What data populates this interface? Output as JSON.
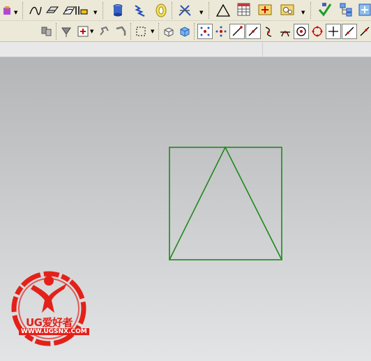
{
  "toolbar_top": {
    "icons": [
      "toolbar-dropdown-icon",
      "spline-curve-icon",
      "surface-icon",
      "layer-settings-icon",
      "cylinder-icon",
      "spring-icon",
      "coil-icon",
      "wireframe-assembly-icon",
      "triangle-icon",
      "table-icon",
      "insert-note-icon",
      "gear-settings-icon",
      "check-icon",
      "hierarchy-icon",
      "unknown-icon"
    ]
  },
  "toolbar_snap": {
    "combo_value": "",
    "icons": [
      "selection-filter-icon",
      "snap-point-icon",
      "select-all-icon",
      "curve-rules-icon",
      "face-rules-icon",
      "rectangle-select-icon",
      "shaded-box-icon",
      "solid-box-icon",
      "snap-grid-icon",
      "snap-end-icon",
      "line-end-icon",
      "line-mid-icon",
      "tangent-icon",
      "intersection-icon",
      "circle-center-icon",
      "quadrant-icon",
      "point-on-curve-icon",
      "point-on-line-icon"
    ]
  },
  "watermark": {
    "brand": "UG爱好者",
    "url": "WWW.UGSNX.COM"
  },
  "colors": {
    "sketch_line": "#1a8a1a",
    "logo_red": "#e32119",
    "toolbar_bg": "#ece9d8"
  }
}
